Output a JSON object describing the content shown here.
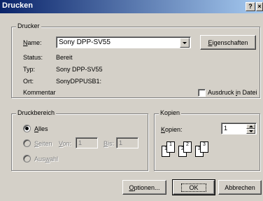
{
  "window": {
    "title": "Drucken",
    "help_label": "?",
    "close_label": "×"
  },
  "printer": {
    "group_label": "Drucker",
    "name_label": "Name:",
    "name_value": "Sony DPP-SV55",
    "properties_button": "Eigenschaften",
    "status_label": "Status:",
    "status_value": "Bereit",
    "type_label": "Typ:",
    "type_value": "Sony DPP-SV55",
    "location_label": "Ort:",
    "location_value": "SonyDPPUSB1:",
    "comment_label": "Kommentar",
    "print_to_file_label": "Ausdruck in Datei"
  },
  "range": {
    "group_label": "Druckbereich",
    "all_label": "Alles",
    "pages_label": "Seiten",
    "from_label": "Von:",
    "from_value": "1",
    "to_label": "Bis:",
    "to_value": "1",
    "selection_label": "Auswahl"
  },
  "copies": {
    "group_label": "Kopien",
    "count_label": "Kopien:",
    "count_value": "1",
    "collate_pages": [
      "1",
      "1",
      "2",
      "2",
      "3",
      "3"
    ]
  },
  "buttons": {
    "options": "Optionen...",
    "ok": "OK",
    "cancel": "Abbrechen"
  }
}
